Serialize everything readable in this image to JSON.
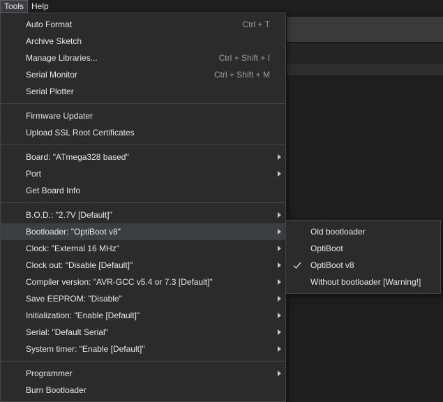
{
  "menubar": {
    "items": [
      {
        "label": "Tools"
      },
      {
        "label": "Help"
      }
    ]
  },
  "tools_menu": {
    "groups": [
      [
        {
          "label": "Auto Format",
          "shortcut": "Ctrl + T"
        },
        {
          "label": "Archive Sketch"
        },
        {
          "label": "Manage Libraries...",
          "shortcut": "Ctrl + Shift + I"
        },
        {
          "label": "Serial Monitor",
          "shortcut": "Ctrl + Shift + M"
        },
        {
          "label": "Serial Plotter"
        }
      ],
      [
        {
          "label": "Firmware Updater"
        },
        {
          "label": "Upload SSL Root Certificates"
        }
      ],
      [
        {
          "label": "Board: \"ATmega328 based\"",
          "submenu": true
        },
        {
          "label": "Port",
          "submenu": true
        },
        {
          "label": "Get Board Info"
        }
      ],
      [
        {
          "label": "B.O.D.: \"2.7V [Default]\"",
          "submenu": true
        },
        {
          "label": "Bootloader: \"OptiBoot v8\"",
          "submenu": true,
          "highlighted": true
        },
        {
          "label": "Clock: \"External 16 MHz\"",
          "submenu": true
        },
        {
          "label": "Clock out: \"Disable [Default]\"",
          "submenu": true
        },
        {
          "label": "Compiler version: \"AVR-GCC v5.4 or 7.3 [Default]\"",
          "submenu": true
        },
        {
          "label": "Save EEPROM: \"Disable\"",
          "submenu": true
        },
        {
          "label": "Initialization: \"Enable [Default]\"",
          "submenu": true
        },
        {
          "label": "Serial: \"Default Serial\"",
          "submenu": true
        },
        {
          "label": "System timer: \"Enable [Default]\"",
          "submenu": true
        }
      ],
      [
        {
          "label": "Programmer",
          "submenu": true
        },
        {
          "label": "Burn Bootloader"
        }
      ]
    ]
  },
  "bootloader_submenu": {
    "items": [
      {
        "label": "Old bootloader",
        "checked": false
      },
      {
        "label": "OptiBoot",
        "checked": false
      },
      {
        "label": "OptiBoot v8",
        "checked": true
      },
      {
        "label": "Without bootloader [Warning!]",
        "checked": false
      }
    ]
  },
  "icons": {
    "check": "checkmark-icon",
    "submenu_arrow": "chevron-right-icon"
  },
  "colors": {
    "menu_bg": "#2b2b2b",
    "highlight_bg": "#3c3f42",
    "text": "#e8e8e8",
    "shortcut_text": "#9d9d9d"
  }
}
